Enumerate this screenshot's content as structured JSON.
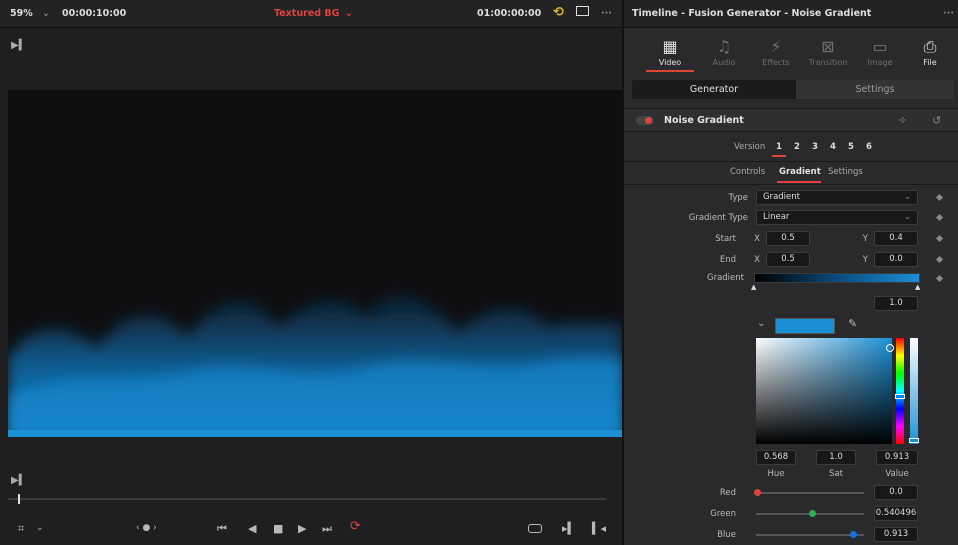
{
  "viewer": {
    "zoom": "59%",
    "timecode": "00:00:10:00",
    "clip_title": "Textured BG",
    "timecode_right": "01:00:00:00"
  },
  "inspector": {
    "title": "Timeline - Fusion Generator - Noise Gradient",
    "tabs": [
      "Video",
      "Audio",
      "Effects",
      "Transition",
      "Image",
      "File"
    ],
    "segments": [
      "Generator",
      "Settings"
    ],
    "effect_name": "Noise Gradient",
    "version_label": "Version",
    "versions": [
      "1",
      "2",
      "3",
      "4",
      "5",
      "6"
    ],
    "subtabs": [
      "Controls",
      "Gradient",
      "Settings"
    ],
    "type_label": "Type",
    "type_value": "Gradient",
    "gradient_type_label": "Gradient Type",
    "gradient_type_value": "Linear",
    "start_label": "Start",
    "end_label": "End",
    "x_label": "X",
    "y_label": "Y",
    "start_x": "0.5",
    "start_y": "0.4",
    "end_x": "0.5",
    "end_y": "0.0",
    "gradient_label": "Gradient",
    "alpha_value": "1.0",
    "swatch_color": "#1a8fd6",
    "hue": "0.568",
    "sat": "1.0",
    "value": "0.913",
    "hue_label": "Hue",
    "sat_label": "Sat",
    "value_label": "Value",
    "red_label": "Red",
    "green_label": "Green",
    "blue_label": "Blue",
    "red": "0.0",
    "green": "0.540496",
    "blue": "0.913"
  },
  "colors": {
    "accent": "#e0433a",
    "blue": "#1a8fd6"
  }
}
